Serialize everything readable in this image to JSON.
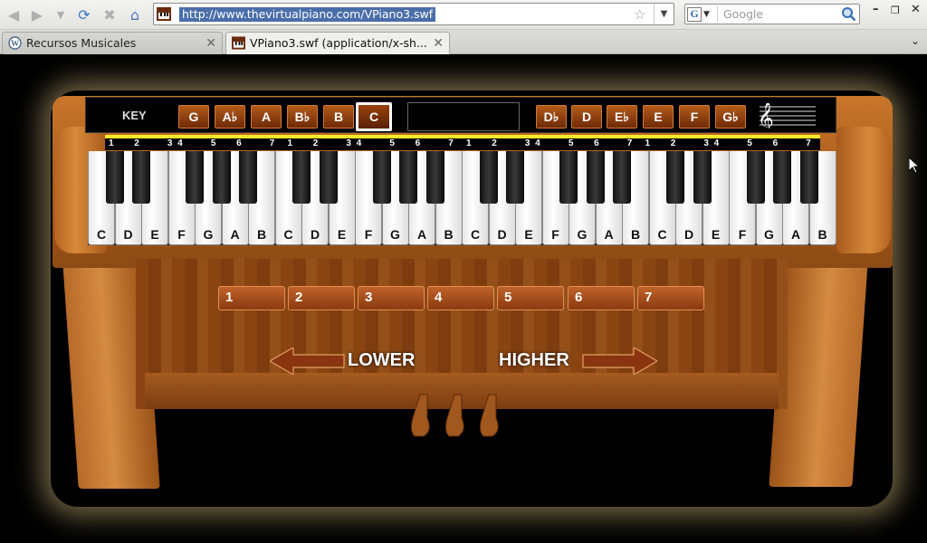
{
  "browser": {
    "url": "http://www.thevirtualpiano.com/VPiano3.swf",
    "search_placeholder": "Google",
    "search_engine_letter": "G",
    "tabs": [
      {
        "label": "Recursos Musicales",
        "active": false
      },
      {
        "label": "VPiano3.swf (application/x-sh...",
        "active": true
      }
    ]
  },
  "piano": {
    "key_label": "KEY",
    "key_buttons_left": [
      {
        "label": "G",
        "selected": false
      },
      {
        "label": "A♭",
        "selected": false
      },
      {
        "label": "A",
        "selected": false
      },
      {
        "label": "B♭",
        "selected": false
      },
      {
        "label": "B",
        "selected": false
      },
      {
        "label": "C",
        "selected": true
      }
    ],
    "key_buttons_right": [
      {
        "label": "D♭",
        "selected": false
      },
      {
        "label": "D",
        "selected": false
      },
      {
        "label": "E♭",
        "selected": false
      },
      {
        "label": "E",
        "selected": false
      },
      {
        "label": "F",
        "selected": false
      },
      {
        "label": "G♭",
        "selected": false
      }
    ],
    "scale_degrees": [
      "1",
      "2",
      "3",
      "4",
      "5",
      "6",
      "7",
      "1",
      "2",
      "3",
      "4",
      "5",
      "6",
      "7",
      "1",
      "2",
      "3",
      "4",
      "5",
      "6",
      "7",
      "1",
      "2",
      "3",
      "4",
      "5",
      "6",
      "7"
    ],
    "white_keys": [
      "C",
      "D",
      "E",
      "F",
      "G",
      "A",
      "B",
      "C",
      "D",
      "E",
      "F",
      "G",
      "A",
      "B",
      "C",
      "D",
      "E",
      "F",
      "G",
      "A",
      "B",
      "C",
      "D",
      "E",
      "F",
      "G",
      "A",
      "B"
    ],
    "octave_buttons": [
      "1",
      "2",
      "3",
      "4",
      "5",
      "6",
      "7"
    ],
    "lower_label": "LOWER",
    "higher_label": "HIGHER"
  },
  "colors": {
    "accent_yellow": "#f5e92c",
    "wood": "#a85a1a",
    "button": "#8a3a10"
  }
}
